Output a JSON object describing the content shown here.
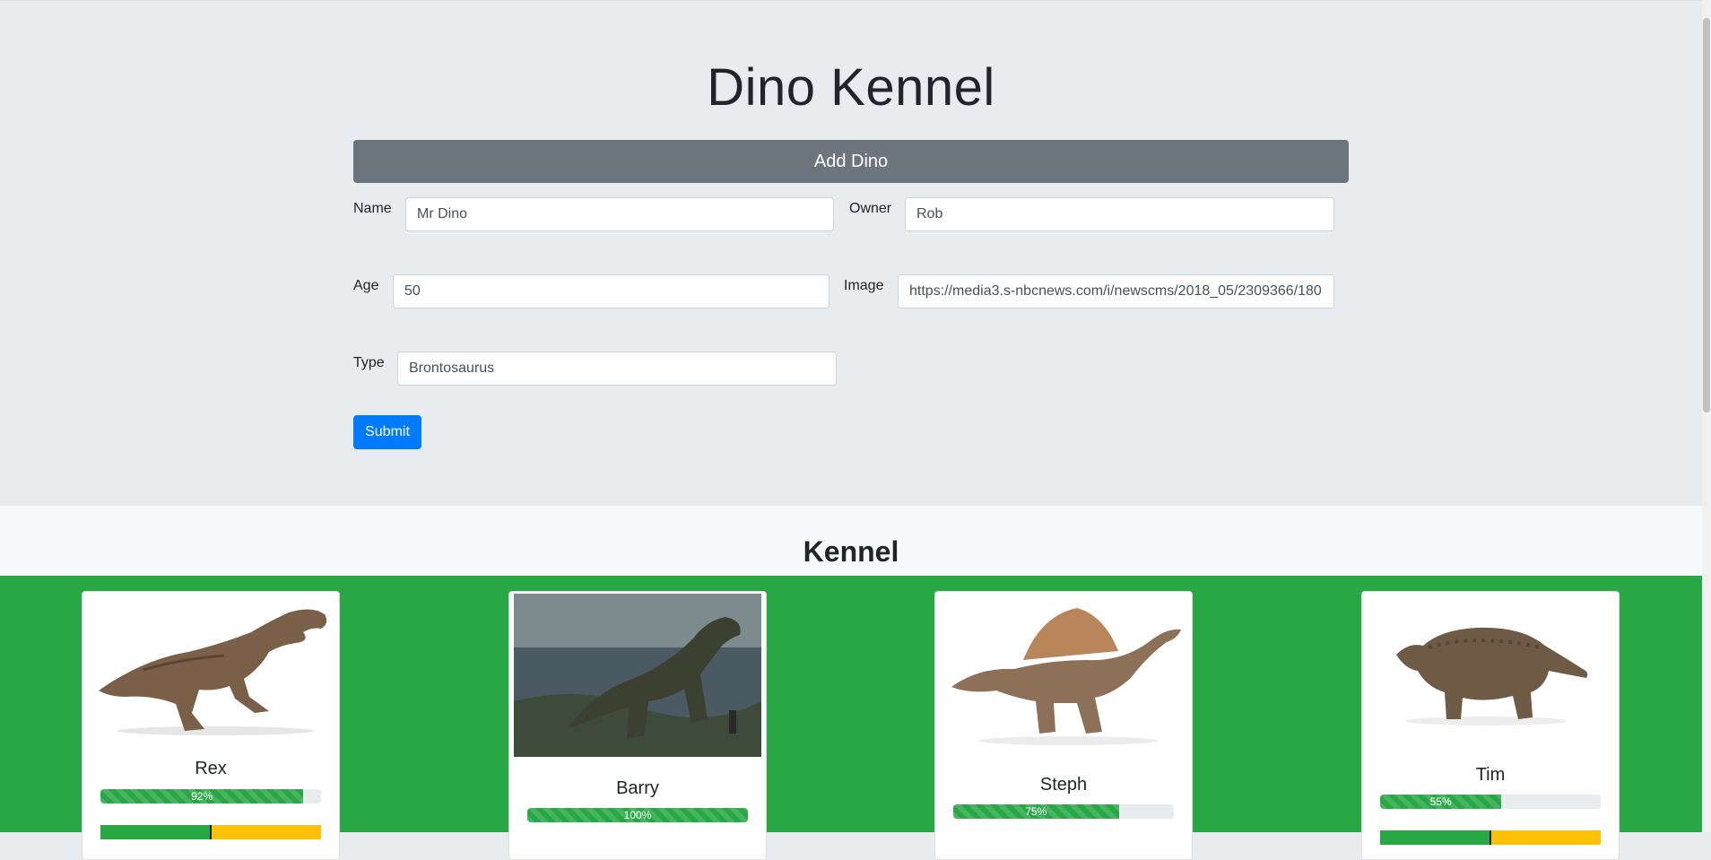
{
  "header": {
    "title": "Dino Kennel",
    "add_label": "Add Dino"
  },
  "form": {
    "name_label": "Name",
    "name_value": "Mr Dino",
    "owner_label": "Owner",
    "owner_value": "Rob",
    "age_label": "Age",
    "age_value": "50",
    "image_label": "Image",
    "image_value": "https://media3.s-nbcnews.com/i/newscms/2018_05/2309366/180",
    "type_label": "Type",
    "type_value": "Brontosaurus",
    "submit_label": "Submit"
  },
  "kennel": {
    "title": "Kennel",
    "cards": [
      {
        "name": "Rex",
        "progress_label": "92%",
        "progress": 0.92,
        "image_icon": "t-rex-image"
      },
      {
        "name": "Barry",
        "progress_label": "100%",
        "progress": 1.0,
        "image_icon": "t-rex-scene-image"
      },
      {
        "name": "Steph",
        "progress_label": "75%",
        "progress": 0.75,
        "image_icon": "spinosaurus-image"
      },
      {
        "name": "Tim",
        "progress_label": "55%",
        "progress": 0.55,
        "image_icon": "ankylosaurus-image"
      }
    ]
  },
  "colors": {
    "accent": "#007bff",
    "kennel_bg": "#28a745",
    "bar_bg": "#6c757d",
    "warning": "#ffc107"
  }
}
